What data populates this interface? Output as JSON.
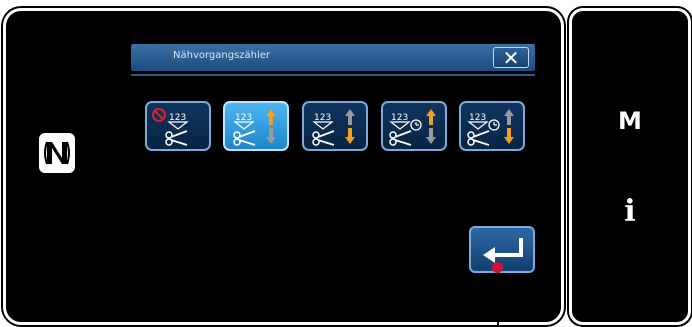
{
  "dialog": {
    "title": "Nähvorgangszähler",
    "close_label": "✕"
  },
  "mode_buttons": [
    {
      "name": "counter-disabled",
      "icon": "counter-disabled-icon",
      "selected": false
    },
    {
      "name": "counter-up",
      "icon": "counter-up-icon",
      "selected": true
    },
    {
      "name": "counter-down",
      "icon": "counter-down-icon",
      "selected": false
    },
    {
      "name": "timer-counter-up",
      "icon": "timer-up-icon",
      "selected": false
    },
    {
      "name": "timer-counter-down",
      "icon": "timer-down-icon",
      "selected": false
    }
  ],
  "side_menu": {
    "menu_label": "M",
    "info_label": "i"
  },
  "colors": {
    "accent_orange": "#f5a01a",
    "arrow_gray": "#9a9a9a",
    "selected_blue": "#3aa6e8",
    "header_blue": "#2c5f94",
    "callout_red": "#d0103a"
  }
}
